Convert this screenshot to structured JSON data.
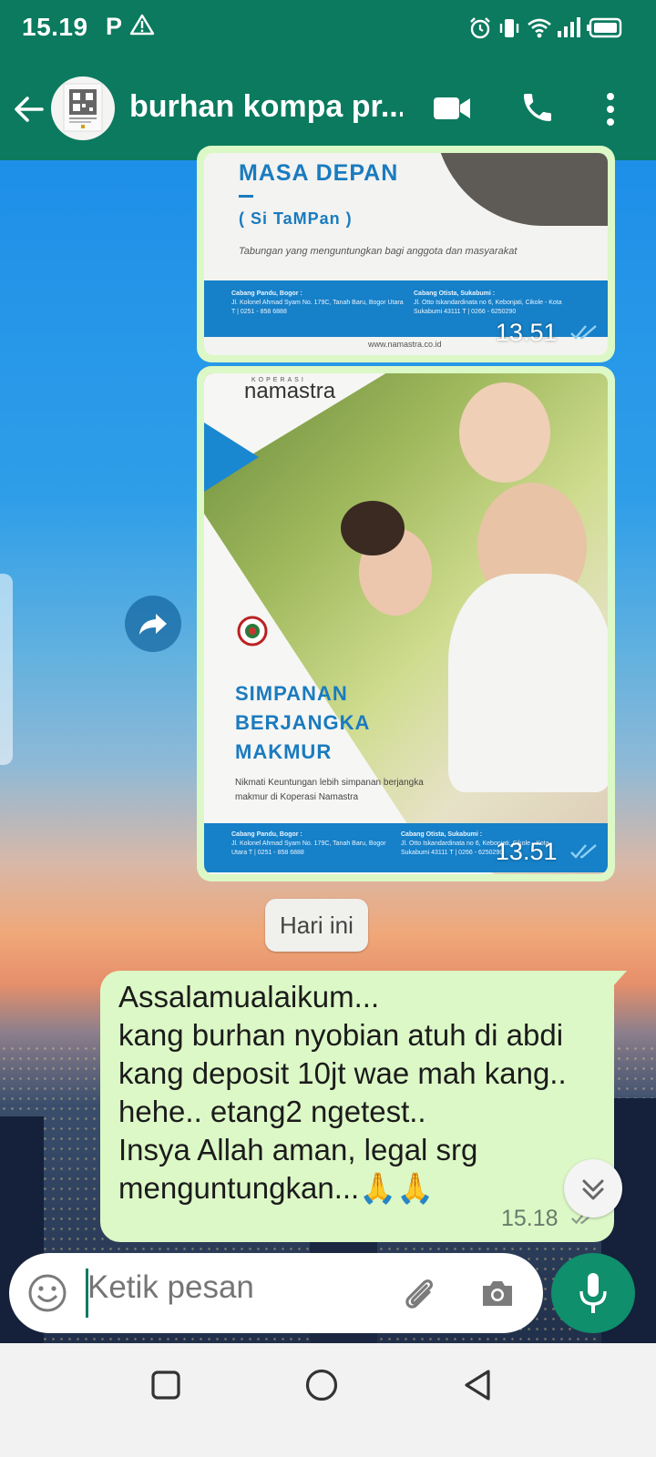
{
  "status_bar": {
    "time": "15.19",
    "p_label": "P",
    "icons": [
      "warning-icon",
      "alarm-icon",
      "vibrate-icon",
      "wifi-icon",
      "signal-icon",
      "battery-icon"
    ]
  },
  "header": {
    "contact_name": "burhan kompa pr...",
    "icons": [
      "back-arrow-icon",
      "video-call-icon",
      "phone-icon",
      "more-vert-icon"
    ]
  },
  "messages": [
    {
      "type": "image",
      "time": "13.51",
      "status": "read",
      "flyer": {
        "title": "MASA DEPAN",
        "dash": "—",
        "subtitle": "( Si TaMPan )",
        "tagline": "Tabungan yang menguntungkan bagi anggota dan masyarakat",
        "branch_left_title": "Cabang Pandu, Bogor :",
        "branch_left_addr": "Jl. Kolonel Ahmad Syam No. 179C, Tanah Baru, Bogor Utara  T | 0251 - 858 6888",
        "branch_right_title": "Cabang Otista, Sukabumi :",
        "branch_right_addr": "Jl. Otto Iskandardinata no 6, Kebonjati, Cikole - Kota Sukabumi 43111  T | 0266 - 6250290",
        "website": "www.namastra.co.id"
      }
    },
    {
      "type": "image",
      "time": "13.51",
      "status": "read",
      "flyer": {
        "brand_small": "KOPERASI",
        "brand": "namastra",
        "title_lines": [
          "SIMPANAN",
          "BERJANGKA",
          "MAKMUR"
        ],
        "desc": "Nikmati Keuntungan lebih simpanan berjangka makmur di Koperasi Namastra",
        "branch_left_title": "Cabang Pandu, Bogor :",
        "branch_left_addr": "Jl. Kolonel Ahmad Syam No. 179C, Tanah Baru, Bogor Utara  T | 0251 - 858 6888",
        "branch_right_title": "Cabang Otista, Sukabumi :",
        "branch_right_addr": "Jl. Otto Iskandardinata no 6, Kebonjati, Cikole - Kota Sukabumi 43111  T | 0266 - 6250290"
      }
    },
    {
      "type": "date",
      "label": "Hari ini"
    },
    {
      "type": "text",
      "text": "Assalamualaikum...\nkang burhan nyobian atuh di abdi kang deposit 10jt wae mah kang.. hehe.. etang2 ngetest..\nInsya Allah aman, legal srg menguntungkan...🙏🙏",
      "time": "15.18",
      "status": "delivered"
    }
  ],
  "input": {
    "placeholder": "Ketik pesan"
  },
  "colors": {
    "header": "#0b7a5f",
    "bubble_out": "#dcf8c6",
    "mic_button": "#0f8f6c",
    "read_ticks": "#53bdeb"
  },
  "nav_icons": [
    "recents-square-icon",
    "home-circle-icon",
    "back-triangle-icon"
  ]
}
